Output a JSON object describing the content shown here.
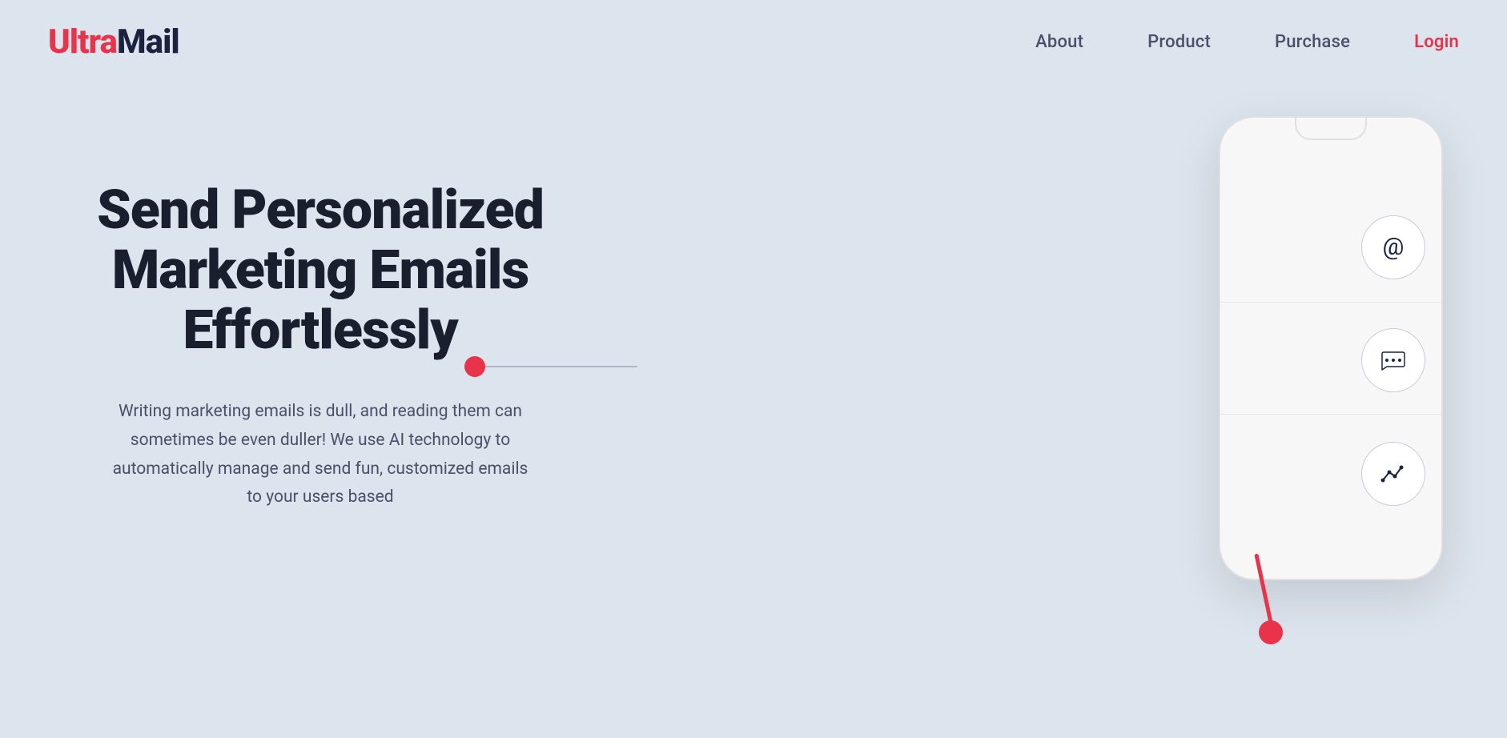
{
  "brand": {
    "ultra": "Ultra",
    "mail": "Mail"
  },
  "nav": {
    "about": "About",
    "product": "Product",
    "purchase": "Purchase",
    "login": "Login"
  },
  "hero": {
    "title": "Send Personalized Marketing Emails Effortlessly",
    "description": "Writing marketing emails is dull, and reading them can sometimes be even duller! We use AI technology to automatically manage and send fun, customized emails to your users based"
  },
  "colors": {
    "accent": "#e8334a",
    "dark": "#1c2340",
    "bg": "#dce4ed",
    "text_muted": "#4a5068"
  },
  "phone": {
    "icons": [
      {
        "type": "at",
        "label": "email-icon"
      },
      {
        "type": "chat",
        "label": "chat-icon"
      },
      {
        "type": "chart",
        "label": "chart-icon"
      }
    ]
  }
}
